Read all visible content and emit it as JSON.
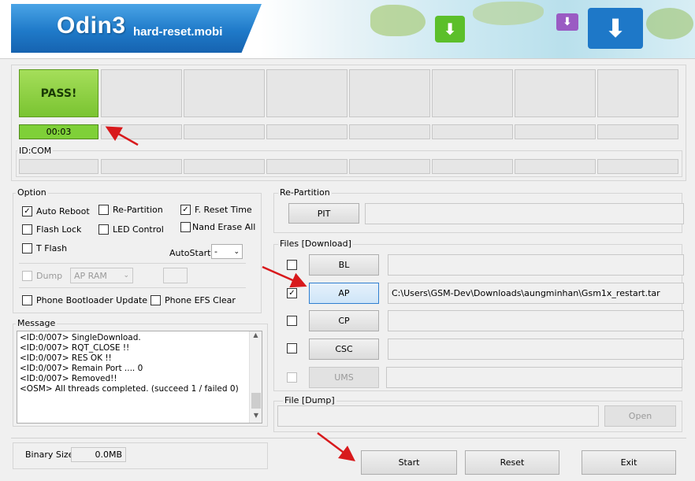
{
  "banner": {
    "app_name": "Odin3",
    "site": "hard-reset.mobi"
  },
  "status": {
    "result": "PASS!",
    "timer": "00:03",
    "id_com_label": "ID:COM"
  },
  "option": {
    "title": "Option",
    "auto_reboot": "Auto Reboot",
    "re_partition": "Re-Partition",
    "f_reset_time": "F. Reset Time",
    "flash_lock": "Flash Lock",
    "led_control": "LED Control",
    "nand_erase_all": "Nand Erase All",
    "t_flash": "T Flash",
    "autostart_label": "AutoStart",
    "autostart_value": "-",
    "dump": "Dump",
    "dump_select": "AP RAM",
    "phone_bootloader_update": "Phone Bootloader Update",
    "phone_efs_clear": "Phone EFS Clear"
  },
  "message": {
    "title": "Message",
    "lines": [
      "<ID:0/007> SingleDownload.",
      "<ID:0/007> RQT_CLOSE !!",
      "<ID:0/007> RES OK !!",
      "<ID:0/007> Remain Port ....  0",
      "<ID:0/007> Removed!!",
      "<OSM> All threads completed. (succeed 1 / failed 0)"
    ]
  },
  "binary": {
    "label": "Binary Size",
    "value": "0.0MB"
  },
  "repartition": {
    "title": "Re-Partition",
    "pit_button": "PIT"
  },
  "files": {
    "title": "Files [Download]",
    "bl": "BL",
    "ap": "AP",
    "ap_path": "C:\\Users\\GSM-Dev\\Downloads\\aungminhan\\Gsm1x_restart.tar",
    "cp": "CP",
    "csc": "CSC",
    "ums": "UMS"
  },
  "dump": {
    "title": "File [Dump]",
    "open_button": "Open"
  },
  "actions": {
    "start": "Start",
    "reset": "Reset",
    "exit": "Exit"
  },
  "colors": {
    "pass_green": "#7ac431",
    "arrow_red": "#d8191c",
    "banner_blue": "#1f7ac9"
  }
}
